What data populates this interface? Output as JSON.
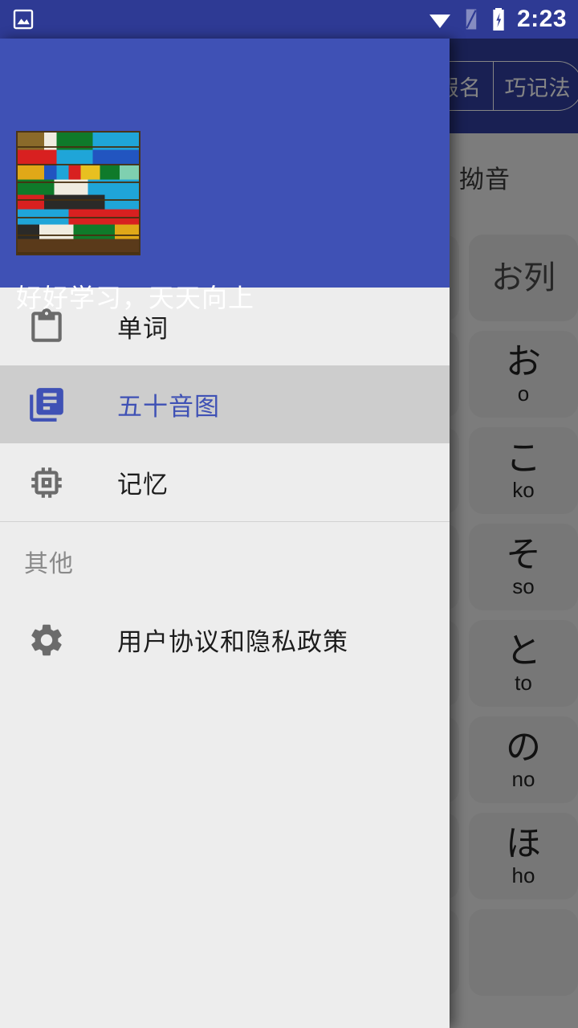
{
  "status_bar": {
    "time": "2:23",
    "icons": [
      "image-icon",
      "wifi-icon",
      "signal-icon",
      "battery-charging-icon"
    ],
    "background_color": "#2E3A94"
  },
  "drawer": {
    "header": {
      "title": "好好学习，天天向上",
      "image_alt": "colorful-brick-wall",
      "background_color": "#3F51B5"
    },
    "items": [
      {
        "label": "单词",
        "icon": "clipboard-icon",
        "selected": false
      },
      {
        "label": "五十音图",
        "icon": "library-books-icon",
        "selected": true
      },
      {
        "label": "记忆",
        "icon": "memory-chip-icon",
        "selected": false
      }
    ],
    "section_label": "其他",
    "other_items": [
      {
        "label": "用户协议和隐私政策",
        "icon": "gear-icon",
        "selected": false
      }
    ],
    "selected_color": "#3F51B5",
    "selected_row_background": "#CDCDCD",
    "background_color": "#EDEDED"
  },
  "background_app": {
    "toolbar": {
      "background_color": "#303F9F",
      "segmented_buttons": [
        {
          "label": "片假名",
          "active": false
        },
        {
          "label": "巧记法",
          "active": false
        }
      ]
    },
    "section_title": "拗音",
    "kana_cards": [
      {
        "kana": "お列",
        "romaji": "",
        "is_header": true
      },
      {
        "kana": "お",
        "romaji": "o",
        "is_header": false
      },
      {
        "kana": "こ",
        "romaji": "ko",
        "is_header": false
      },
      {
        "kana": "そ",
        "romaji": "so",
        "is_header": false
      },
      {
        "kana": "と",
        "romaji": "to",
        "is_header": false
      },
      {
        "kana": "の",
        "romaji": "no",
        "is_header": false
      },
      {
        "kana": "ほ",
        "romaji": "ho",
        "is_header": false
      }
    ],
    "scrim_opacity": "0.48"
  }
}
